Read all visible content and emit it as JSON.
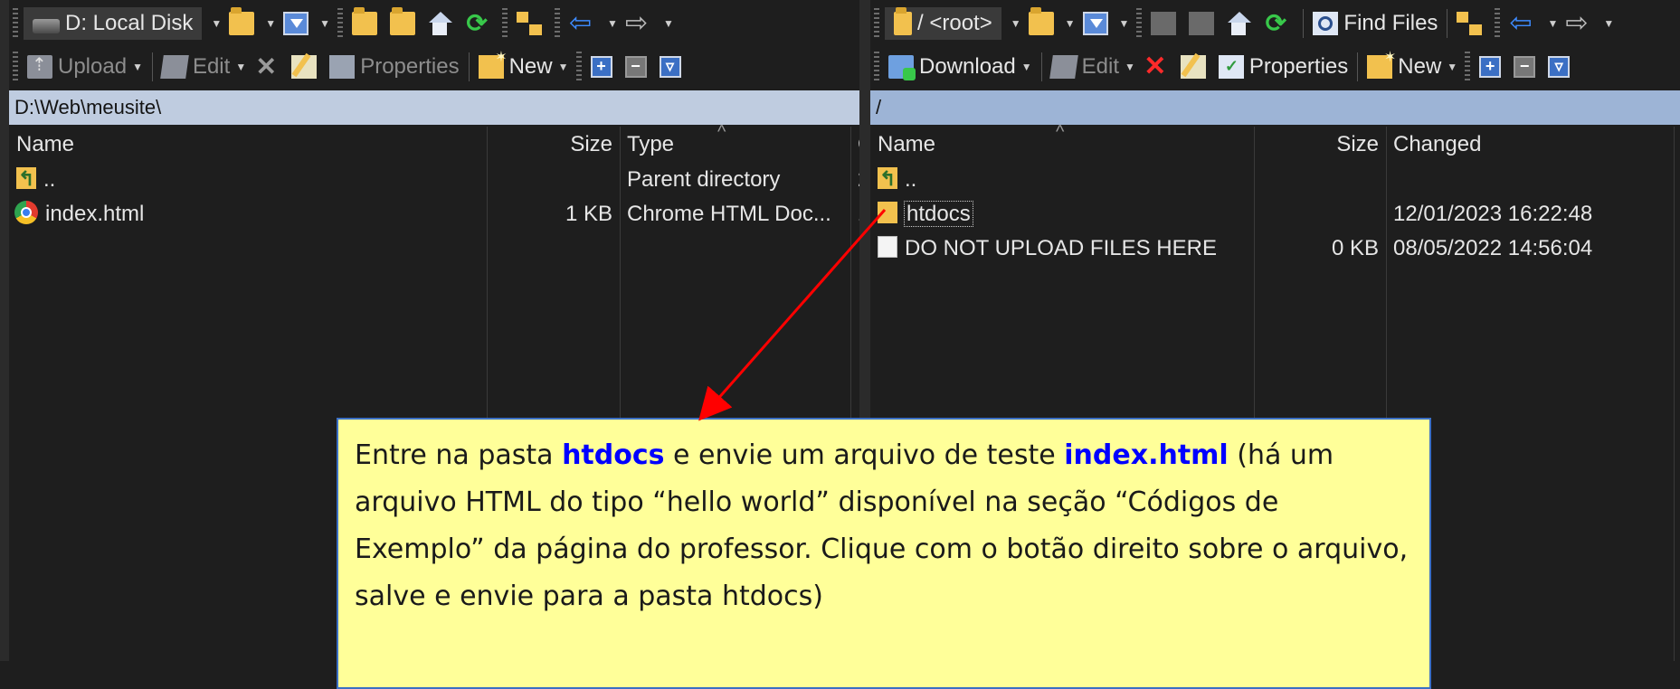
{
  "left": {
    "toolbar1": {
      "drive_label": "D: Local Disk"
    },
    "toolbar2": {
      "upload": "Upload",
      "edit": "Edit",
      "properties": "Properties",
      "new": "New"
    },
    "path": "D:\\Web\\meusite\\",
    "columns": {
      "name": "Name",
      "size": "Size",
      "type": "Type",
      "changed_trunc": "C"
    },
    "rows": [
      {
        "name": "..",
        "size": "",
        "type": "Parent directory",
        "changed_trunc": "2",
        "icon": "parent-folder-icon"
      },
      {
        "name": "index.html",
        "size": "1 KB",
        "type": "Chrome HTML Doc...",
        "changed_trunc": "1",
        "icon": "chrome-icon"
      }
    ]
  },
  "right": {
    "toolbar1": {
      "path_label": "/ <root>",
      "find_files": "Find Files"
    },
    "toolbar2": {
      "download": "Download",
      "edit": "Edit",
      "properties": "Properties",
      "new": "New"
    },
    "path": "/",
    "columns": {
      "name": "Name",
      "size": "Size",
      "changed": "Changed"
    },
    "rows": [
      {
        "name": "..",
        "size": "",
        "changed": "",
        "icon": "parent-folder-icon"
      },
      {
        "name": "htdocs",
        "size": "",
        "changed": "12/01/2023 16:22:48",
        "icon": "folder-icon"
      },
      {
        "name": "DO NOT UPLOAD FILES HERE",
        "size": "0 KB",
        "changed": "08/05/2022 14:56:04",
        "icon": "document-icon"
      }
    ]
  },
  "callout": {
    "t1": "Entre na pasta ",
    "h1": "htdocs",
    "t2": " e envie um arquivo de teste ",
    "h2": "index.html",
    "t3": " (há um arquivo HTML do tipo “hello world” disponível na seção “Códigos de Exemplo” da página do professor. Clique com o botão direito sobre o arquivo, salve e envie para a pasta htdocs)"
  },
  "colors": {
    "highlight": "#0000ff",
    "callout_bg": "#ffff99",
    "arrow": "#ff0000"
  }
}
